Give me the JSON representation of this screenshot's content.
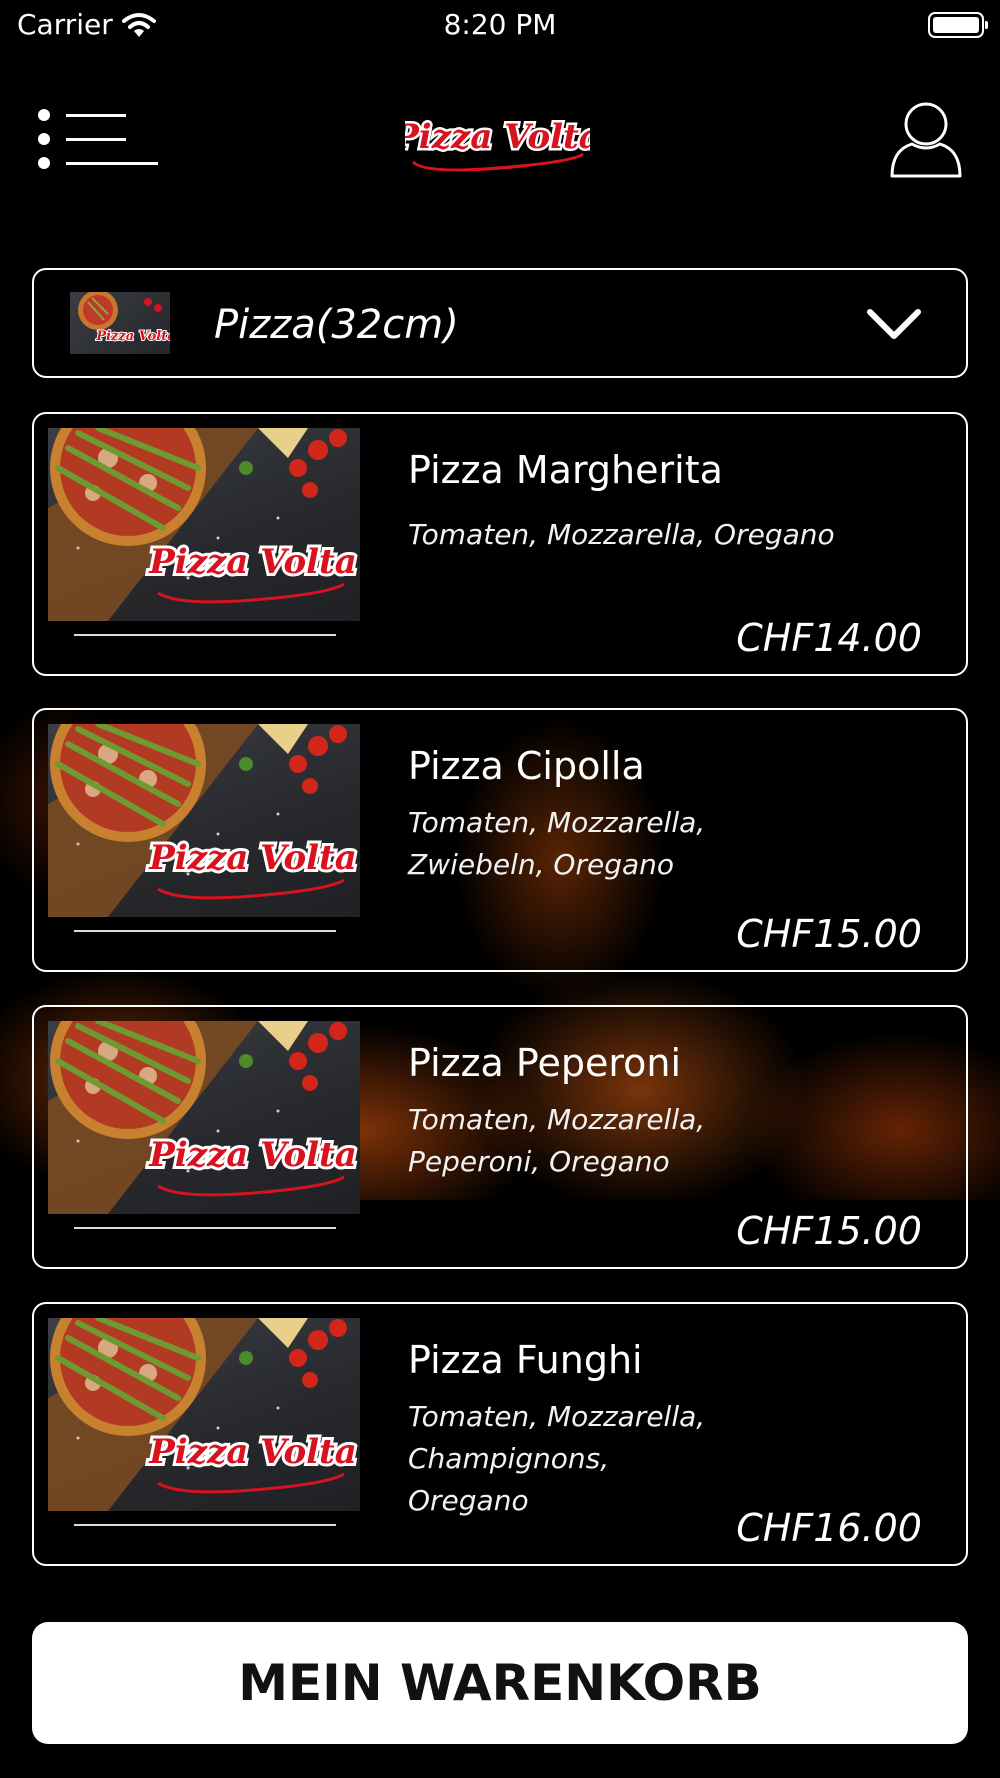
{
  "status_bar": {
    "carrier": "Carrier",
    "time": "8:20 PM"
  },
  "header": {
    "logo_text": "Pizza Volta"
  },
  "category": {
    "label": "Pizza(32cm)"
  },
  "items": [
    {
      "name": "Pizza Margherita",
      "description": "Tomaten, Mozzarella, Oregano",
      "price": "CHF14.00"
    },
    {
      "name": "Pizza Cipolla",
      "description": "Tomaten, Mozzarella, Zwiebeln, Oregano",
      "price": "CHF15.00"
    },
    {
      "name": "Pizza Peperoni",
      "description": "Tomaten, Mozzarella, Peperoni, Oregano",
      "price": "CHF15.00"
    },
    {
      "name": "Pizza Funghi",
      "description": "Tomaten, Mozzarella, Champignons, Oregano",
      "price": "CHF16.00"
    }
  ],
  "cart": {
    "label": "MEIN WARENKORB"
  },
  "colors": {
    "background": "#000000",
    "brand_red": "#d8121e",
    "text": "#ffffff",
    "button_bg": "#ffffff"
  }
}
